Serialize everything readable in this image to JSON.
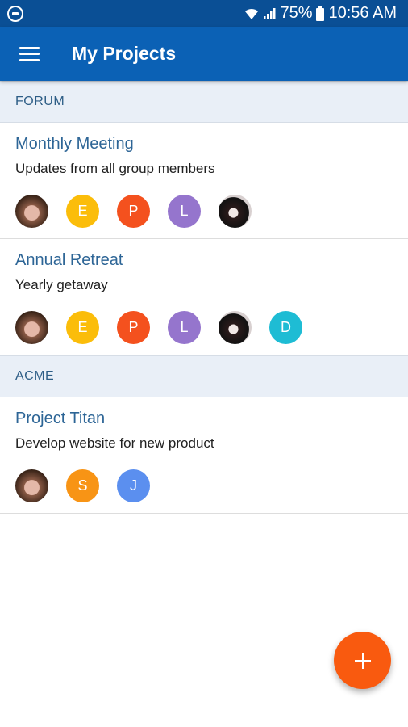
{
  "status_bar": {
    "battery_percent": "75%",
    "time": "10:56 AM",
    "left_icon": "notification-icon",
    "icons": [
      "wifi-icon",
      "signal-icon",
      "battery-icon"
    ]
  },
  "app_bar": {
    "title": "My Projects",
    "menu_icon": "hamburger-menu-icon",
    "color": "#0b61b5"
  },
  "sections": [
    {
      "header": "FORUM",
      "projects": [
        {
          "title": "Monthly Meeting",
          "description": "Updates from all group members",
          "members": [
            {
              "type": "photo",
              "icon": "user-photo-avatar"
            },
            {
              "type": "initial",
              "letter": "E",
              "color": "#fbbd0a"
            },
            {
              "type": "initial",
              "letter": "P",
              "color": "#f4511e"
            },
            {
              "type": "initial",
              "letter": "L",
              "color": "#9575cd"
            },
            {
              "type": "photo",
              "icon": "user-photo-avatar"
            }
          ]
        },
        {
          "title": "Annual Retreat",
          "description": "Yearly getaway",
          "members": [
            {
              "type": "photo",
              "icon": "user-photo-avatar"
            },
            {
              "type": "initial",
              "letter": "E",
              "color": "#fbbd0a"
            },
            {
              "type": "initial",
              "letter": "P",
              "color": "#f4511e"
            },
            {
              "type": "initial",
              "letter": "L",
              "color": "#9575cd"
            },
            {
              "type": "photo",
              "icon": "user-photo-avatar"
            },
            {
              "type": "initial",
              "letter": "D",
              "color": "#1ebcd4"
            }
          ]
        }
      ]
    },
    {
      "header": "ACME",
      "projects": [
        {
          "title": "Project Titan",
          "description": "Develop website for new product",
          "members": [
            {
              "type": "photo",
              "icon": "user-photo-avatar"
            },
            {
              "type": "initial",
              "letter": "S",
              "color": "#f89415"
            },
            {
              "type": "initial",
              "letter": "J",
              "color": "#5b8fef"
            }
          ]
        }
      ]
    }
  ],
  "fab": {
    "icon": "plus-icon",
    "color": "#f95a0f"
  }
}
